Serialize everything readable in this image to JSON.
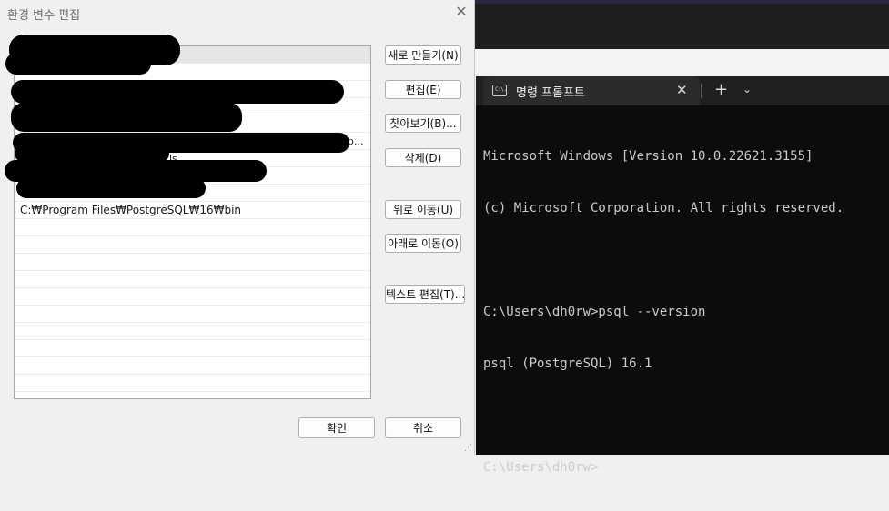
{
  "dialog": {
    "title": "환경 변수 편집",
    "close_glyph": "✕",
    "entries": [
      {
        "text": "",
        "redacted": true
      },
      {
        "text": "",
        "redacted": true
      },
      {
        "text": "",
        "redacted": true
      },
      {
        "text": "",
        "redacted": true
      },
      {
        "text": "",
        "redacted": true
      },
      {
        "text": "",
        "redacted": true
      },
      {
        "text": "",
        "redacted": true
      },
      {
        "text": "",
        "redacted": true
      },
      {
        "text": "",
        "redacted": true
      },
      {
        "text": "C:₩Program Files₩PostgreSQL₩16₩bin",
        "redacted": false
      }
    ],
    "partial_fragments": {
      "b_tail": "₩b...",
      "ls_tail": "ls"
    },
    "buttons": {
      "new": "새로 만들기(N)",
      "edit": "편집(E)",
      "browse": "찾아보기(B)...",
      "delete": "삭제(D)",
      "move_up": "위로 이동(U)",
      "move_down": "아래로 이동(O)",
      "edit_text": "텍스트 편집(T)..."
    },
    "footer": {
      "ok": "확인",
      "cancel": "취소"
    }
  },
  "terminal": {
    "tab_title": "명령 프롬프트",
    "tab_icon_text": "C:\\.",
    "close_glyph": "✕",
    "new_tab_glyph": "+",
    "dropdown_glyph": "⌄",
    "lines": [
      "Microsoft Windows [Version 10.0.22621.3155]",
      "(c) Microsoft Corporation. All rights reserved.",
      "",
      "C:\\Users\\dh0rw>psql --version",
      "psql (PostgreSQL) 16.1",
      "",
      "C:\\Users\\dh0rw>"
    ]
  }
}
